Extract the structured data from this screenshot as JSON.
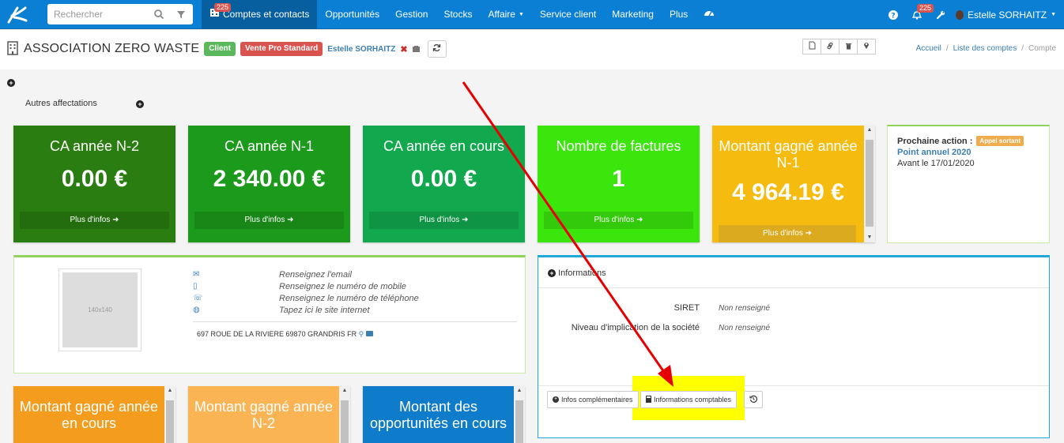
{
  "header": {
    "search_placeholder": "Rechercher",
    "nav": [
      {
        "label": "Comptes et contacts",
        "badge": "225"
      },
      {
        "label": "Opportunités"
      },
      {
        "label": "Gestion"
      },
      {
        "label": "Stocks"
      },
      {
        "label": "Affaire"
      },
      {
        "label": "Service client"
      },
      {
        "label": "Marketing"
      },
      {
        "label": "Plus"
      }
    ],
    "notif_badge": "225",
    "user_name": "Estelle SORHAITZ"
  },
  "account": {
    "name": "ASSOCIATION ZERO WASTE",
    "label_client": "Client",
    "label_segment": "Vente Pro Standard",
    "owner": "Estelle SORHAITZ"
  },
  "breadcrumb": [
    "Accueil",
    "Liste des comptes",
    "Compte"
  ],
  "sections": {
    "autres_affectations": "Autres affectations"
  },
  "tiles": [
    {
      "title": "CA année N-2",
      "value": "0.00 €",
      "more": "Plus d'infos",
      "color": "#2a7d10"
    },
    {
      "title": "CA année N-1",
      "value": "2 340.00 €",
      "more": "Plus d'infos",
      "color": "#1c9a1c"
    },
    {
      "title": "CA année en cours",
      "value": "0.00 €",
      "more": "Plus d'infos",
      "color": "#12a84e"
    },
    {
      "title": "Nombre de factures",
      "value": "1",
      "more": "Plus d'infos",
      "color": "#3ae60c"
    },
    {
      "title": "Montant gagné année N-1",
      "value": "4 964.19 €",
      "more": "Plus d'infos",
      "color": "#f5bb0f"
    }
  ],
  "next_action": {
    "label": "Prochaine action :",
    "badge": "Appel sortant",
    "link": "Point annuel 2020",
    "due": "Avant le 17/01/2020"
  },
  "contact": {
    "photo_placeholder": "140x140",
    "email": "Renseignez l'email",
    "mobile": "Renseignez le numéro de mobile",
    "phone": "Renseignez le numéro de téléphone",
    "website": "Tapez ici le site internet",
    "address": "697 ROUE DE LA RIVIERE 69870 GRANDRIS FR"
  },
  "info_panel": {
    "title": "Informations",
    "rows": [
      {
        "key": "SIRET",
        "value": "Non renseigné"
      },
      {
        "key": "Niveau d'implication de la société",
        "value": "Non renseigné"
      }
    ],
    "btn_infos": "Infos complémentaires",
    "btn_comptables": "Informations comptables"
  },
  "bottom_tiles": [
    {
      "title": "Montant gagné année en cours",
      "color": "#f39c1d"
    },
    {
      "title": "Montant gagné année N-2",
      "color": "#fbb454"
    },
    {
      "title": "Montant des opportunités en cours",
      "color": "#0f7bcb"
    }
  ],
  "colors": {
    "topbar": "#0a7fd3",
    "annotation_arrow": "#e60000",
    "highlight": "#ffff00"
  }
}
